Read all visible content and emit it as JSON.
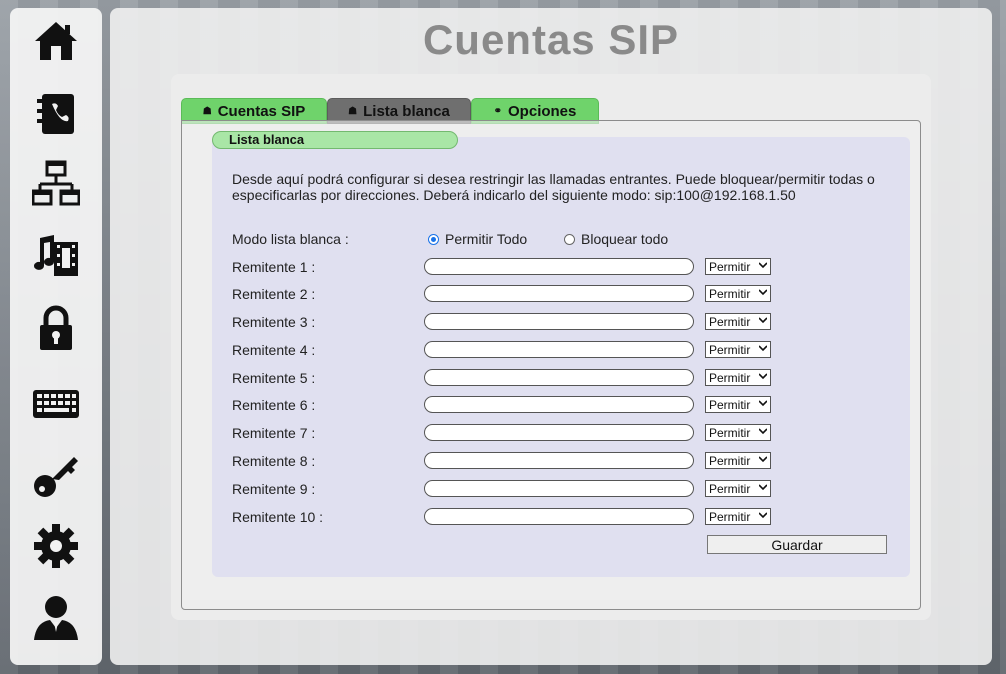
{
  "page": {
    "title": "Cuentas SIP"
  },
  "sidebar": {
    "items": [
      {
        "icon": "home-icon"
      },
      {
        "icon": "phonebook-icon"
      },
      {
        "icon": "network-icon"
      },
      {
        "icon": "media-icon"
      },
      {
        "icon": "lock-icon"
      },
      {
        "icon": "keyboard-icon"
      },
      {
        "icon": "key-icon"
      },
      {
        "icon": "gear-icon"
      },
      {
        "icon": "user-icon"
      }
    ]
  },
  "tabs": [
    {
      "label": "Cuentas SIP",
      "state": "inactive"
    },
    {
      "label": "Lista blanca",
      "state": "active"
    },
    {
      "label": "Opciones",
      "state": "inactive"
    }
  ],
  "section": {
    "label": "Lista blanca"
  },
  "description": "Desde aquí podrá configurar si desea restringir las llamadas entrantes. Puede bloquear/permitir todas o especificarlas por direcciones. Deberá indicarlo del siguiente modo: sip:100@192.168.1.50",
  "mode": {
    "label": "Modo lista blanca :",
    "options": [
      "Permitir Todo",
      "Bloquear todo"
    ],
    "selected": "Permitir Todo"
  },
  "senders": [
    {
      "label": "Remitente 1 :",
      "value": "",
      "action": "Permitir"
    },
    {
      "label": "Remitente 2 :",
      "value": "",
      "action": "Permitir"
    },
    {
      "label": "Remitente 3 :",
      "value": "",
      "action": "Permitir"
    },
    {
      "label": "Remitente 4 :",
      "value": "",
      "action": "Permitir"
    },
    {
      "label": "Remitente 5 :",
      "value": "",
      "action": "Permitir"
    },
    {
      "label": "Remitente 6 :",
      "value": "",
      "action": "Permitir"
    },
    {
      "label": "Remitente 7 :",
      "value": "",
      "action": "Permitir"
    },
    {
      "label": "Remitente 8 :",
      "value": "",
      "action": "Permitir"
    },
    {
      "label": "Remitente 9 :",
      "value": "",
      "action": "Permitir"
    },
    {
      "label": "Remitente 10 :",
      "value": "",
      "action": "Permitir"
    }
  ],
  "save_label": "Guardar",
  "colors": {
    "tab_green": "#6fd36b",
    "tab_active": "#6f6f6f",
    "section_green": "#a9e6a6",
    "radio_blue": "#1a73e8"
  }
}
